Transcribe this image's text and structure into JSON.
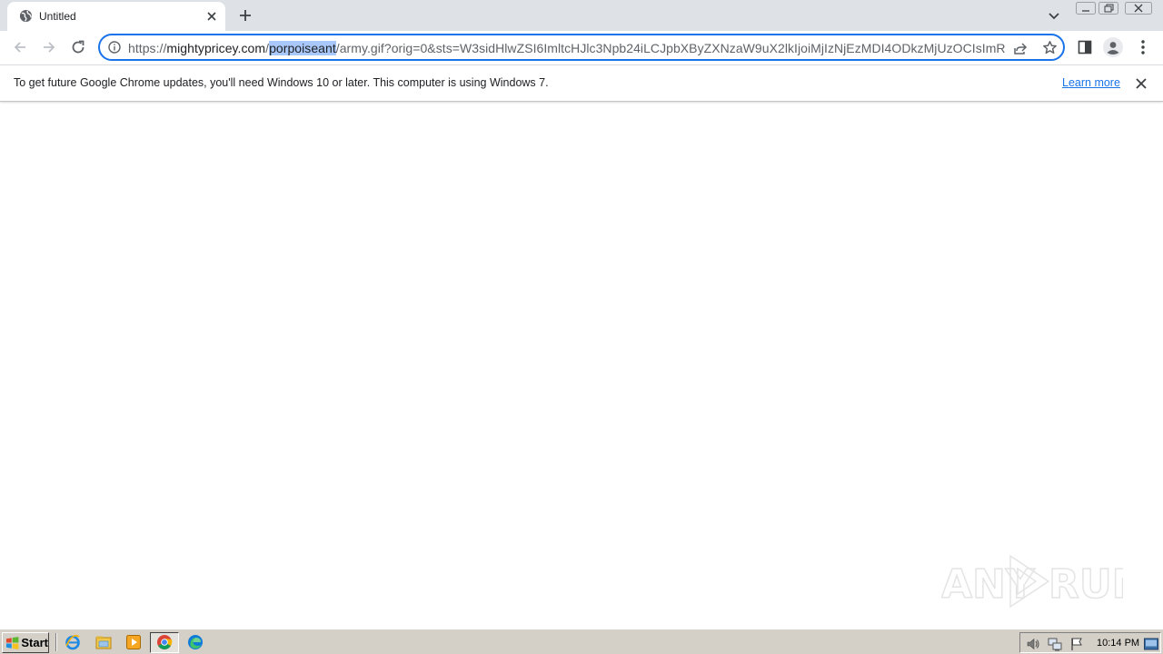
{
  "browser": {
    "tab": {
      "title": "Untitled",
      "favicon": "globe-icon"
    },
    "address_bar": {
      "scheme": "https://",
      "host": "mightypricey.com",
      "path_before": "/",
      "path_selected": "porpoiseant",
      "path_after": "/army.gif?orig=0&sts=W3sidHlwZSI6ImltcHJlc3Npb24iLCJpbXByZXNzaW9uX2lkIjoiMjIzNjEzMDI4ODkzMjUzOCIsImRvbW"
    },
    "toolbar_icons": [
      "back-icon",
      "forward-icon",
      "reload-icon",
      "info-icon",
      "share-icon",
      "star-icon",
      "side-panel-icon",
      "profile-icon",
      "menu-icon"
    ],
    "accent_color": "#1a73e8"
  },
  "infobar": {
    "message": "To get future Google Chrome updates, you'll need Windows 10 or later. This computer is using Windows 7.",
    "link": "Learn more"
  },
  "watermark": {
    "text_left": "ANY",
    "text_right": "RUN"
  },
  "taskbar": {
    "start_label": "Start",
    "pinned": [
      "ie-icon",
      "explorer-icon",
      "media-player-icon",
      "chrome-icon",
      "edge-icon"
    ],
    "tray_icons": [
      "volume-icon",
      "network-icon",
      "flag-icon",
      "show-desktop-icon"
    ],
    "clock": "10:14 PM"
  }
}
